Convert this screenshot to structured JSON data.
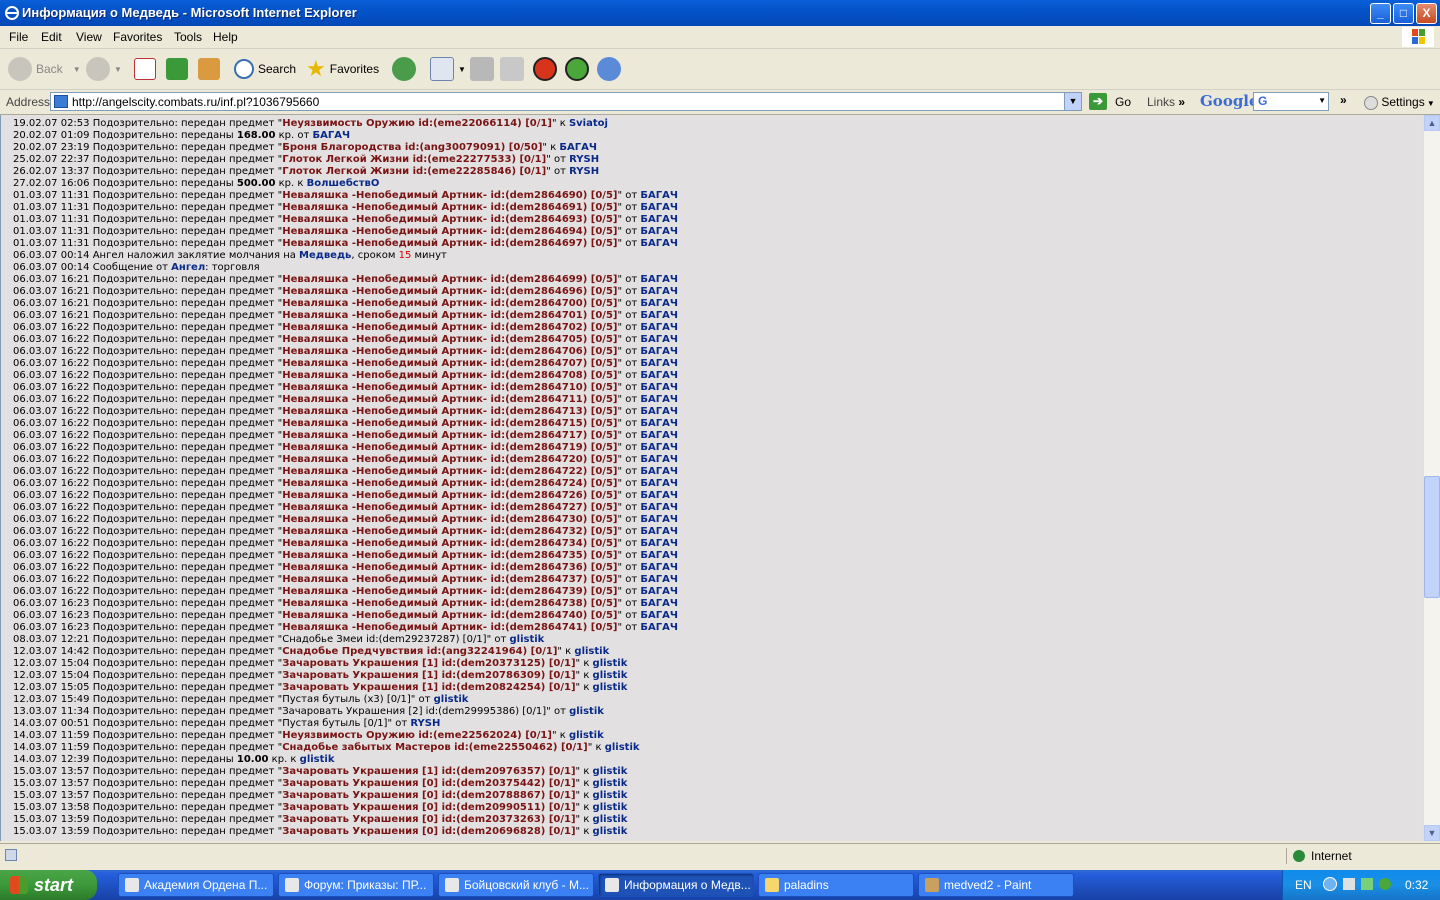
{
  "window": {
    "title": "Информация о Медведь - Microsoft Internet Explorer",
    "buttons": {
      "minimize": "_",
      "maximize": "□",
      "close": "X"
    }
  },
  "menu": {
    "items": [
      "File",
      "Edit",
      "View",
      "Favorites",
      "Tools",
      "Help"
    ]
  },
  "toolbar": {
    "back": "Back",
    "search": "Search",
    "favorites": "Favorites"
  },
  "address": {
    "label": "Address",
    "url": "http://angelscity.combats.ru/inf.pl?1036795660",
    "go": "Go",
    "links": "Links",
    "google": "Google",
    "google_box": "G",
    "settings": "Settings"
  },
  "log": [
    {
      "ts": "19.02.07 02:53",
      "txt": " Подозрительно: передан предмет \"",
      "item": "Неуязвимость Оружию id:(eme22066114) [0/1]",
      "rel": "\" к ",
      "nick": "Sviatoj"
    },
    {
      "ts": "20.02.07 01:09",
      "txt": " Подозрительно: переданы ",
      "num": "168.00",
      "txt2": " кр. от ",
      "nick": "БАГАЧ"
    },
    {
      "ts": "20.02.07 23:19",
      "txt": " Подозрительно: передан предмет \"",
      "item": "Броня Благородства id:(ang30079091) [0/50]",
      "rel": "\" к ",
      "nick": "БАГАЧ"
    },
    {
      "ts": "25.02.07 22:37",
      "txt": " Подозрительно: передан предмет \"",
      "item": "Глоток Легкой Жизни id:(eme22277533) [0/1]",
      "rel": "\" от ",
      "nick": "RYSH"
    },
    {
      "ts": "26.02.07 13:37",
      "txt": " Подозрительно: передан предмет \"",
      "item": "Глоток Легкой Жизни id:(eme22285846) [0/1]",
      "rel": "\" от ",
      "nick": "RYSH"
    },
    {
      "ts": "27.02.07 16:06",
      "txt": " Подозрительно: переданы ",
      "num": "500.00",
      "txt2": " кр. к ",
      "nick": "ВолшебствО"
    },
    {
      "ts": "01.03.07 11:31",
      "txt": " Подозрительно: передан предмет \"",
      "item": "Неваляшка -Непобедимый Артник- id:(dem2864690) [0/5]",
      "rel": "\" от ",
      "nick": "БАГАЧ"
    },
    {
      "ts": "01.03.07 11:31",
      "txt": " Подозрительно: передан предмет \"",
      "item": "Неваляшка -Непобедимый Артник- id:(dem2864691) [0/5]",
      "rel": "\" от ",
      "nick": "БАГАЧ"
    },
    {
      "ts": "01.03.07 11:31",
      "txt": " Подозрительно: передан предмет \"",
      "item": "Неваляшка -Непобедимый Артник- id:(dem2864693) [0/5]",
      "rel": "\" от ",
      "nick": "БАГАЧ"
    },
    {
      "ts": "01.03.07 11:31",
      "txt": " Подозрительно: передан предмет \"",
      "item": "Неваляшка -Непобедимый Артник- id:(dem2864694) [0/5]",
      "rel": "\" от ",
      "nick": "БАГАЧ"
    },
    {
      "ts": "01.03.07 11:31",
      "txt": " Подозрительно: передан предмет \"",
      "item": "Неваляшка -Непобедимый Артник- id:(dem2864697) [0/5]",
      "rel": "\" от ",
      "nick": "БАГАЧ"
    },
    {
      "ts": "06.03.07 00:14",
      "txt": " Ангел наложил заклятие молчания на ",
      "nick": "Медведь",
      "txt3": ", сроком ",
      "red": "15",
      "txt4": " минут"
    },
    {
      "ts": "06.03.07 00:14",
      "txt": " Сообщение от ",
      "nick": "Ангел",
      "txt3": ": торговля"
    },
    {
      "ts": "06.03.07 16:21",
      "txt": " Подозрительно: передан предмет \"",
      "item": "Неваляшка -Непобедимый Артник- id:(dem2864699) [0/5]",
      "rel": "\" от ",
      "nick": "БАГАЧ"
    },
    {
      "ts": "06.03.07 16:21",
      "txt": " Подозрительно: передан предмет \"",
      "item": "Неваляшка -Непобедимый Артник- id:(dem2864696) [0/5]",
      "rel": "\" от ",
      "nick": "БАГАЧ"
    },
    {
      "ts": "06.03.07 16:21",
      "txt": " Подозрительно: передан предмет \"",
      "item": "Неваляшка -Непобедимый Артник- id:(dem2864700) [0/5]",
      "rel": "\" от ",
      "nick": "БАГАЧ"
    },
    {
      "ts": "06.03.07 16:21",
      "txt": " Подозрительно: передан предмет \"",
      "item": "Неваляшка -Непобедимый Артник- id:(dem2864701) [0/5]",
      "rel": "\" от ",
      "nick": "БАГАЧ"
    },
    {
      "ts": "06.03.07 16:22",
      "txt": " Подозрительно: передан предмет \"",
      "item": "Неваляшка -Непобедимый Артник- id:(dem2864702) [0/5]",
      "rel": "\" от ",
      "nick": "БАГАЧ"
    },
    {
      "ts": "06.03.07 16:22",
      "txt": " Подозрительно: передан предмет \"",
      "item": "Неваляшка -Непобедимый Артник- id:(dem2864705) [0/5]",
      "rel": "\" от ",
      "nick": "БАГАЧ"
    },
    {
      "ts": "06.03.07 16:22",
      "txt": " Подозрительно: передан предмет \"",
      "item": "Неваляшка -Непобедимый Артник- id:(dem2864706) [0/5]",
      "rel": "\" от ",
      "nick": "БАГАЧ"
    },
    {
      "ts": "06.03.07 16:22",
      "txt": " Подозрительно: передан предмет \"",
      "item": "Неваляшка -Непобедимый Артник- id:(dem2864707) [0/5]",
      "rel": "\" от ",
      "nick": "БАГАЧ"
    },
    {
      "ts": "06.03.07 16:22",
      "txt": " Подозрительно: передан предмет \"",
      "item": "Неваляшка -Непобедимый Артник- id:(dem2864708) [0/5]",
      "rel": "\" от ",
      "nick": "БАГАЧ"
    },
    {
      "ts": "06.03.07 16:22",
      "txt": " Подозрительно: передан предмет \"",
      "item": "Неваляшка -Непобедимый Артник- id:(dem2864710) [0/5]",
      "rel": "\" от ",
      "nick": "БАГАЧ"
    },
    {
      "ts": "06.03.07 16:22",
      "txt": " Подозрительно: передан предмет \"",
      "item": "Неваляшка -Непобедимый Артник- id:(dem2864711) [0/5]",
      "rel": "\" от ",
      "nick": "БАГАЧ"
    },
    {
      "ts": "06.03.07 16:22",
      "txt": " Подозрительно: передан предмет \"",
      "item": "Неваляшка -Непобедимый Артник- id:(dem2864713) [0/5]",
      "rel": "\" от ",
      "nick": "БАГАЧ"
    },
    {
      "ts": "06.03.07 16:22",
      "txt": " Подозрительно: передан предмет \"",
      "item": "Неваляшка -Непобедимый Артник- id:(dem2864715) [0/5]",
      "rel": "\" от ",
      "nick": "БАГАЧ"
    },
    {
      "ts": "06.03.07 16:22",
      "txt": " Подозрительно: передан предмет \"",
      "item": "Неваляшка -Непобедимый Артник- id:(dem2864717) [0/5]",
      "rel": "\" от ",
      "nick": "БАГАЧ"
    },
    {
      "ts": "06.03.07 16:22",
      "txt": " Подозрительно: передан предмет \"",
      "item": "Неваляшка -Непобедимый Артник- id:(dem2864719) [0/5]",
      "rel": "\" от ",
      "nick": "БАГАЧ"
    },
    {
      "ts": "06.03.07 16:22",
      "txt": " Подозрительно: передан предмет \"",
      "item": "Неваляшка -Непобедимый Артник- id:(dem2864720) [0/5]",
      "rel": "\" от ",
      "nick": "БАГАЧ"
    },
    {
      "ts": "06.03.07 16:22",
      "txt": " Подозрительно: передан предмет \"",
      "item": "Неваляшка -Непобедимый Артник- id:(dem2864722) [0/5]",
      "rel": "\" от ",
      "nick": "БАГАЧ"
    },
    {
      "ts": "06.03.07 16:22",
      "txt": " Подозрительно: передан предмет \"",
      "item": "Неваляшка -Непобедимый Артник- id:(dem2864724) [0/5]",
      "rel": "\" от ",
      "nick": "БАГАЧ"
    },
    {
      "ts": "06.03.07 16:22",
      "txt": " Подозрительно: передан предмет \"",
      "item": "Неваляшка -Непобедимый Артник- id:(dem2864726) [0/5]",
      "rel": "\" от ",
      "nick": "БАГАЧ"
    },
    {
      "ts": "06.03.07 16:22",
      "txt": " Подозрительно: передан предмет \"",
      "item": "Неваляшка -Непобедимый Артник- id:(dem2864727) [0/5]",
      "rel": "\" от ",
      "nick": "БАГАЧ"
    },
    {
      "ts": "06.03.07 16:22",
      "txt": " Подозрительно: передан предмет \"",
      "item": "Неваляшка -Непобедимый Артник- id:(dem2864730) [0/5]",
      "rel": "\" от ",
      "nick": "БАГАЧ"
    },
    {
      "ts": "06.03.07 16:22",
      "txt": " Подозрительно: передан предмет \"",
      "item": "Неваляшка -Непобедимый Артник- id:(dem2864732) [0/5]",
      "rel": "\" от ",
      "nick": "БАГАЧ"
    },
    {
      "ts": "06.03.07 16:22",
      "txt": " Подозрительно: передан предмет \"",
      "item": "Неваляшка -Непобедимый Артник- id:(dem2864734) [0/5]",
      "rel": "\" от ",
      "nick": "БАГАЧ"
    },
    {
      "ts": "06.03.07 16:22",
      "txt": " Подозрительно: передан предмет \"",
      "item": "Неваляшка -Непобедимый Артник- id:(dem2864735) [0/5]",
      "rel": "\" от ",
      "nick": "БАГАЧ"
    },
    {
      "ts": "06.03.07 16:22",
      "txt": " Подозрительно: передан предмет \"",
      "item": "Неваляшка -Непобедимый Артник- id:(dem2864736) [0/5]",
      "rel": "\" от ",
      "nick": "БАГАЧ"
    },
    {
      "ts": "06.03.07 16:22",
      "txt": " Подозрительно: передан предмет \"",
      "item": "Неваляшка -Непобедимый Артник- id:(dem2864737) [0/5]",
      "rel": "\" от ",
      "nick": "БАГАЧ"
    },
    {
      "ts": "06.03.07 16:22",
      "txt": " Подозрительно: передан предмет \"",
      "item": "Неваляшка -Непобедимый Артник- id:(dem2864739) [0/5]",
      "rel": "\" от ",
      "nick": "БАГАЧ"
    },
    {
      "ts": "06.03.07 16:23",
      "txt": " Подозрительно: передан предмет \"",
      "item": "Неваляшка -Непобедимый Артник- id:(dem2864738) [0/5]",
      "rel": "\" от ",
      "nick": "БАГАЧ"
    },
    {
      "ts": "06.03.07 16:23",
      "txt": " Подозрительно: передан предмет \"",
      "item": "Неваляшка -Непобедимый Артник- id:(dem2864740) [0/5]",
      "rel": "\" от ",
      "nick": "БАГАЧ"
    },
    {
      "ts": "06.03.07 16:23",
      "txt": " Подозрительно: передан предмет \"",
      "item": "Неваляшка -Непобедимый Артник- id:(dem2864741) [0/5]",
      "rel": "\" от ",
      "nick": "БАГАЧ"
    },
    {
      "ts": "08.03.07 12:21",
      "txt": " Подозрительно: передан предмет \"Снадобье Змеи id:(dem29237287) [0/1]\" от ",
      "nick": "glistik"
    },
    {
      "ts": "12.03.07 14:42",
      "txt": " Подозрительно: передан предмет \"",
      "item": "Снадобье Предчувствия id:(ang32241964) [0/1]",
      "rel": "\" к ",
      "nick": "glistik"
    },
    {
      "ts": "12.03.07 15:04",
      "txt": " Подозрительно: передан предмет \"",
      "item": "Зачаровать Украшения [1] id:(dem20373125) [0/1]",
      "rel": "\" к ",
      "nick": "glistik"
    },
    {
      "ts": "12.03.07 15:04",
      "txt": " Подозрительно: передан предмет \"",
      "item": "Зачаровать Украшения [1] id:(dem20786309) [0/1]",
      "rel": "\" к ",
      "nick": "glistik"
    },
    {
      "ts": "12.03.07 15:05",
      "txt": " Подозрительно: передан предмет \"",
      "item": "Зачаровать Украшения [1] id:(dem20824254) [0/1]",
      "rel": "\" к ",
      "nick": "glistik"
    },
    {
      "ts": "12.03.07 15:49",
      "txt": " Подозрительно: передан предмет \"Пустая бутыль (x3) [0/1]\" от ",
      "nick": "glistik"
    },
    {
      "ts": "13.03.07 11:34",
      "txt": " Подозрительно: передан предмет \"Зачаровать Украшения [2] id:(dem29995386) [0/1]\" от ",
      "nick": "glistik"
    },
    {
      "ts": "14.03.07 00:51",
      "txt": " Подозрительно: передан предмет \"Пустая бутыль [0/1]\" от ",
      "nick": "RYSH"
    },
    {
      "ts": "14.03.07 11:59",
      "txt": " Подозрительно: передан предмет \"",
      "item": "Неуязвимость Оружию id:(eme22562024) [0/1]",
      "rel": "\" к ",
      "nick": "glistik"
    },
    {
      "ts": "14.03.07 11:59",
      "txt": " Подозрительно: передан предмет \"",
      "item": "Снадобье забытых Мастеров id:(eme22550462) [0/1]",
      "rel": "\" к ",
      "nick": "glistik"
    },
    {
      "ts": "14.03.07 12:39",
      "txt": " Подозрительно: переданы ",
      "num": "10.00",
      "txt2": " кр. к ",
      "nick": "glistik"
    },
    {
      "ts": "15.03.07 13:57",
      "txt": " Подозрительно: передан предмет \"",
      "item": "Зачаровать Украшения [1] id:(dem20976357) [0/1]",
      "rel": "\" к ",
      "nick": "glistik"
    },
    {
      "ts": "15.03.07 13:57",
      "txt": " Подозрительно: передан предмет \"",
      "item": "Зачаровать Украшения [0] id:(dem20375442) [0/1]",
      "rel": "\" к ",
      "nick": "glistik"
    },
    {
      "ts": "15.03.07 13:57",
      "txt": " Подозрительно: передан предмет \"",
      "item": "Зачаровать Украшения [0] id:(dem20788867) [0/1]",
      "rel": "\" к ",
      "nick": "glistik"
    },
    {
      "ts": "15.03.07 13:58",
      "txt": " Подозрительно: передан предмет \"",
      "item": "Зачаровать Украшения [0] id:(dem20990511) [0/1]",
      "rel": "\" к ",
      "nick": "glistik"
    },
    {
      "ts": "15.03.07 13:59",
      "txt": " Подозрительно: передан предмет \"",
      "item": "Зачаровать Украшения [0] id:(dem20373263) [0/1]",
      "rel": "\" к ",
      "nick": "glistik"
    },
    {
      "ts": "15.03.07 13:59",
      "txt": " Подозрительно: передан предмет \"",
      "item": "Зачаровать Украшения [0] id:(dem20696828) [0/1]",
      "rel": "\" к ",
      "nick": "glistik"
    }
  ],
  "status": {
    "zone": "Internet"
  },
  "taskbar": {
    "start": "start",
    "tasks": [
      "Академия Ордена П...",
      "Форум: Приказы: ПР...",
      "Бойцовский клуб - М...",
      "Информация о Медв...",
      "paladins",
      "medved2 - Paint"
    ],
    "lang": "EN",
    "clock": "0:32"
  }
}
